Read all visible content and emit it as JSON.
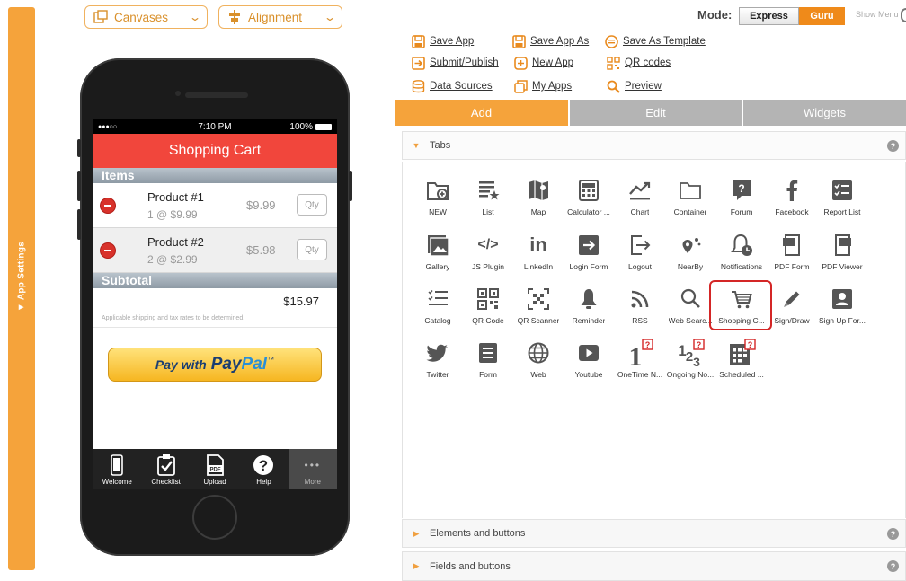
{
  "sidebar": {
    "label": "▼ App Settings"
  },
  "toolbar": {
    "canvases_label": "Canvases",
    "alignment_label": "Alignment"
  },
  "mode": {
    "label": "Mode:",
    "express": "Express",
    "guru": "Guru",
    "show_menu": "Show Menu"
  },
  "actions": [
    {
      "label": "Save App",
      "icon": "save-icon"
    },
    {
      "label": "Save App As",
      "icon": "save-as-icon"
    },
    {
      "label": "Save As Template",
      "icon": "template-icon"
    },
    {
      "label": "Submit/Publish",
      "icon": "publish-icon"
    },
    {
      "label": "New App",
      "icon": "new-app-icon"
    },
    {
      "label": "QR codes",
      "icon": "qr-icon"
    },
    {
      "label": "Data Sources",
      "icon": "database-icon"
    },
    {
      "label": "My Apps",
      "icon": "my-apps-icon"
    },
    {
      "label": "Preview",
      "icon": "preview-icon"
    }
  ],
  "panel_tabs": [
    "Add",
    "Edit",
    "Widgets"
  ],
  "accordions": {
    "tabs": "Tabs",
    "elements": "Elements and buttons",
    "fields": "Fields and buttons",
    "help": "?"
  },
  "widgets": [
    {
      "label": "NEW",
      "icon": "new-folder-icon"
    },
    {
      "label": "List",
      "icon": "list-icon"
    },
    {
      "label": "Map",
      "icon": "map-icon"
    },
    {
      "label": "Calculator ...",
      "icon": "calculator-icon"
    },
    {
      "label": "Chart",
      "icon": "chart-icon"
    },
    {
      "label": "Container",
      "icon": "folder-icon"
    },
    {
      "label": "Forum",
      "icon": "forum-icon"
    },
    {
      "label": "Facebook",
      "icon": "facebook-icon"
    },
    {
      "label": "Report List",
      "icon": "report-list-icon"
    },
    {
      "label": "Gallery",
      "icon": "gallery-icon"
    },
    {
      "label": "JS Plugin",
      "icon": "code-icon"
    },
    {
      "label": "LinkedIn",
      "icon": "linkedin-icon"
    },
    {
      "label": "Login Form",
      "icon": "login-icon"
    },
    {
      "label": "Logout",
      "icon": "logout-icon"
    },
    {
      "label": "NearBy",
      "icon": "nearby-icon"
    },
    {
      "label": "Notifications",
      "icon": "notifications-icon"
    },
    {
      "label": "PDF Form",
      "icon": "pdf-form-icon"
    },
    {
      "label": "PDF Viewer",
      "icon": "pdf-viewer-icon"
    },
    {
      "label": "Catalog",
      "icon": "catalog-icon"
    },
    {
      "label": "QR Code",
      "icon": "qr-code-icon"
    },
    {
      "label": "QR Scanner",
      "icon": "qr-scanner-icon"
    },
    {
      "label": "Reminder",
      "icon": "bell-icon"
    },
    {
      "label": "RSS",
      "icon": "rss-icon"
    },
    {
      "label": "Web Searc...",
      "icon": "search-icon"
    },
    {
      "label": "Shopping C...",
      "icon": "shopping-cart-icon"
    },
    {
      "label": "Sign/Draw",
      "icon": "pencil-icon"
    },
    {
      "label": "Sign Up For...",
      "icon": "signup-icon"
    },
    {
      "label": "Twitter",
      "icon": "twitter-icon"
    },
    {
      "label": "Form",
      "icon": "form-icon"
    },
    {
      "label": "Web",
      "icon": "globe-icon"
    },
    {
      "label": "Youtube",
      "icon": "youtube-icon"
    },
    {
      "label": "OneTime N...",
      "icon": "onetime-icon"
    },
    {
      "label": "Ongoing No...",
      "icon": "ongoing-icon"
    },
    {
      "label": "Scheduled ...",
      "icon": "scheduled-icon"
    }
  ],
  "phone": {
    "status_signal": "●●●○○",
    "status_time": "7:10 PM",
    "status_battery": "100%",
    "title": "Shopping Cart",
    "items_header": "Items",
    "products": [
      {
        "name": "Product #1",
        "detail": "1 @ $9.99",
        "price": "$9.99",
        "qty": "Qty"
      },
      {
        "name": "Product #2",
        "detail": "2 @ $2.99",
        "price": "$5.98",
        "qty": "Qty"
      }
    ],
    "subtotal_header": "Subtotal",
    "subtotal_value": "$15.97",
    "note": "Applicable shipping and tax rates to be determined.",
    "paypal_with": "Pay with",
    "paypal_pay": "Pay",
    "paypal_pal": "Pal",
    "paypal_tm": "™",
    "tabbar": [
      "Welcome",
      "Checklist",
      "Upload",
      "Help",
      "More"
    ]
  },
  "colors": {
    "accent": "#f5a33b",
    "guru": "#ef8a1a",
    "cart_header": "#f1463c",
    "highlight": "#d42626"
  }
}
